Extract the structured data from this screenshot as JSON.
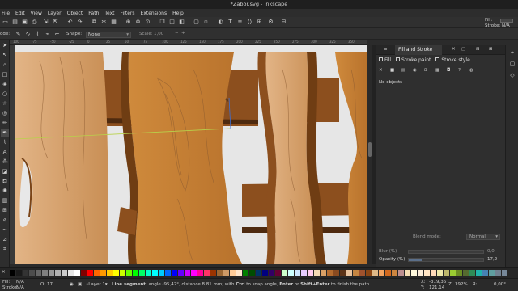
{
  "window": {
    "title": "*Zabor.svg - Inkscape"
  },
  "menu": [
    "File",
    "Edit",
    "View",
    "Layer",
    "Object",
    "Path",
    "Text",
    "Filters",
    "Extensions",
    "Help"
  ],
  "tool_controls": {
    "mode_label": "ode:",
    "shape_label": "Shape:",
    "shape_value": "None",
    "scale_label": "Scale:",
    "scale_value": "1,00"
  },
  "style_indicator": {
    "fill_label": "Fill:",
    "stroke_label": "Stroke:",
    "stroke_value": "N/A"
  },
  "ruler_ticks": [
    "100",
    "-75",
    "-50",
    "-25",
    "0",
    "25",
    "50",
    "75",
    "100",
    "125",
    "150",
    "175",
    "200",
    "225",
    "250",
    "275",
    "300",
    "325",
    "350"
  ],
  "panel": {
    "tab_label": "Fill and Stroke",
    "tabs": [
      "Fill",
      "Stroke paint",
      "Stroke style"
    ],
    "no_objects": "No objects",
    "blend_label": "Blend mode:",
    "blend_value": "Normal",
    "blur_label": "Blur (%)",
    "blur_value": "0,0",
    "opacity_label": "Opacity (%)",
    "opacity_value": "17,2"
  },
  "status": {
    "fill_label": "Fill:",
    "fill_value": "N/A",
    "stroke_label": "Stroke:",
    "stroke_value": "N/A",
    "opacity_label": "O:",
    "opacity_value": "17",
    "layer": "Layer 1",
    "message_bold1": "Line segment",
    "message_rest1": ": angle -95,42°, distance 8.81 mm; with ",
    "message_bold2": "Ctrl",
    "message_rest2": " to snap angle, ",
    "message_bold3": "Enter",
    "message_rest3": " or ",
    "message_bold4": "Shift+Enter",
    "message_rest4": " to finish the path",
    "x_label": "X:",
    "x_value": "-319,36",
    "y_label": "Y:",
    "y_value": "121,14",
    "zoom_label": "Z:",
    "zoom_value": "392%",
    "rotate_label": "R:",
    "rotate_value": "0,00°"
  },
  "palette_colors": [
    "#000000",
    "#1a1a1a",
    "#333333",
    "#4d4d4d",
    "#666666",
    "#808080",
    "#999999",
    "#b3b3b3",
    "#cccccc",
    "#e6e6e6",
    "#ffffff",
    "#800000",
    "#ff0000",
    "#ff6600",
    "#ff9900",
    "#ffcc00",
    "#ffff00",
    "#ccff00",
    "#66ff00",
    "#00ff00",
    "#00ff66",
    "#00ffcc",
    "#00ffff",
    "#00ccff",
    "#0066ff",
    "#0000ff",
    "#6600ff",
    "#cc00ff",
    "#ff00ff",
    "#ff0099",
    "#ff3366",
    "#993300",
    "#996633",
    "#cc9966",
    "#ffcc99",
    "#ffe6cc",
    "#008000",
    "#004d00",
    "#003366",
    "#000080",
    "#330066",
    "#660033",
    "#ccffcc",
    "#ccffff",
    "#cce6ff",
    "#e6ccff",
    "#ffccee",
    "#f2d9b3",
    "#d9a066",
    "#b36b2e",
    "#8a4b20",
    "#5c3317",
    "#e8c39e",
    "#c68642",
    "#a0522d",
    "#8b4513",
    "#deb887",
    "#f4a460",
    "#d2691e",
    "#cd853f",
    "#bc8f8f",
    "#f5deb3",
    "#fff8dc",
    "#faebd7",
    "#ffe4c4",
    "#ffdab9",
    "#eee8aa",
    "#bdb76b",
    "#9acd32",
    "#6b8e23",
    "#556b2f",
    "#2e8b57",
    "#20b2aa",
    "#4682b4",
    "#5f9ea0",
    "#708090",
    "#778899"
  ],
  "colors": {
    "wood_light": "#d8a06e",
    "wood_mid": "#c78035",
    "wood_dark": "#7a4417",
    "wood_band": "#8c4f1e",
    "bg": "#e6e6e6"
  }
}
